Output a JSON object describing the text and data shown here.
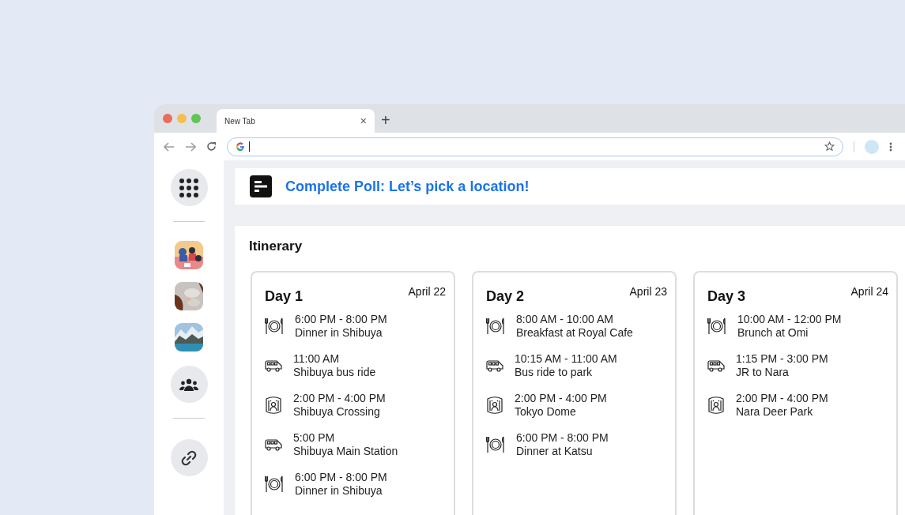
{
  "browser": {
    "tab": {
      "title": "New Tab",
      "close": "×"
    },
    "new_tab": "+"
  },
  "sidebar": {
    "items": [
      {
        "kind": "apps"
      },
      {
        "kind": "divider"
      },
      {
        "kind": "picture"
      },
      {
        "kind": "picture"
      },
      {
        "kind": "picture"
      },
      {
        "kind": "people"
      },
      {
        "kind": "divider"
      },
      {
        "kind": "link"
      }
    ]
  },
  "poll": {
    "title": "Complete Poll: Let’s pick a location!"
  },
  "itinerary": {
    "title": "Itinerary",
    "days": [
      {
        "title": "Day 1",
        "date": "April 22",
        "events": [
          {
            "kind": "dining",
            "time": "6:00 PM - 8:00 PM",
            "name": "Dinner in Shibuya"
          },
          {
            "kind": "bus",
            "time": "11:00 AM",
            "name": "Shibuya bus ride"
          },
          {
            "kind": "venue",
            "time": "2:00 PM - 4:00 PM",
            "name": "Shibuya Crossing"
          },
          {
            "kind": "bus",
            "time": "5:00 PM",
            "name": "Shibuya Main Station"
          },
          {
            "kind": "dining",
            "time": "6:00 PM - 8:00 PM",
            "name": "Dinner in Shibuya"
          }
        ]
      },
      {
        "title": "Day 2",
        "date": "April 23",
        "events": [
          {
            "kind": "dining",
            "time": "8:00 AM - 10:00 AM",
            "name": "Breakfast at Royal Cafe"
          },
          {
            "kind": "bus",
            "time": "10:15 AM - 11:00 AM",
            "name": "Bus ride to park"
          },
          {
            "kind": "venue",
            "time": "2:00 PM - 4:00 PM",
            "name": "Tokyo Dome"
          },
          {
            "kind": "dining",
            "time": "6:00 PM - 8:00 PM",
            "name": "Dinner at Katsu"
          }
        ]
      },
      {
        "title": "Day 3",
        "date": "April 24",
        "events": [
          {
            "kind": "dining",
            "time": "10:00 AM - 12:00 PM",
            "name": "Brunch at Omi"
          },
          {
            "kind": "bus",
            "time": "1:15 PM - 3:00 PM",
            "name": "JR to Nara"
          },
          {
            "kind": "venue",
            "time": "2:00 PM - 4:00 PM",
            "name": "Nara Deer Park"
          }
        ]
      }
    ]
  }
}
